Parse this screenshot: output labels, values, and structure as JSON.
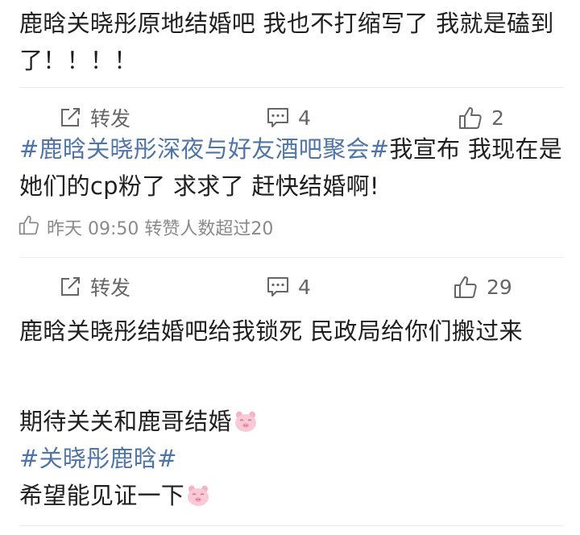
{
  "comments": [
    {
      "text": "鹿晗关晓彤原地结婚吧 我也不打缩写了 我就是磕到了！！！！"
    },
    {
      "hashtag": "#鹿晗关晓彤深夜与好友酒吧聚会#",
      "text": "我宣布 我现在是她们的cp粉了 求求了 赶快结婚啊!",
      "meta": "昨天 09:50 转赞人数超过20"
    },
    {
      "text": "鹿晗关晓彤结婚吧给我锁死 民政局给你们搬过来"
    },
    {
      "line1": "期待关关和鹿哥结婚",
      "hashtag": "#关晓彤鹿晗#",
      "line3": "希望能见证一下"
    }
  ],
  "action_bars": [
    {
      "repost_label": "转发",
      "comment_count": "4",
      "like_count": "2"
    },
    {
      "repost_label": "转发",
      "comment_count": "4",
      "like_count": "29"
    }
  ],
  "icons": {
    "repost": "share-icon",
    "comment": "comment-icon",
    "like": "thumbs-up-icon",
    "emoji": "pig-face-emoji"
  },
  "colors": {
    "hashtag": "#4f74a8",
    "text": "#1f1f1f",
    "muted": "#666666",
    "meta": "#8a8a8a",
    "emoji": "#f6b3c6"
  }
}
